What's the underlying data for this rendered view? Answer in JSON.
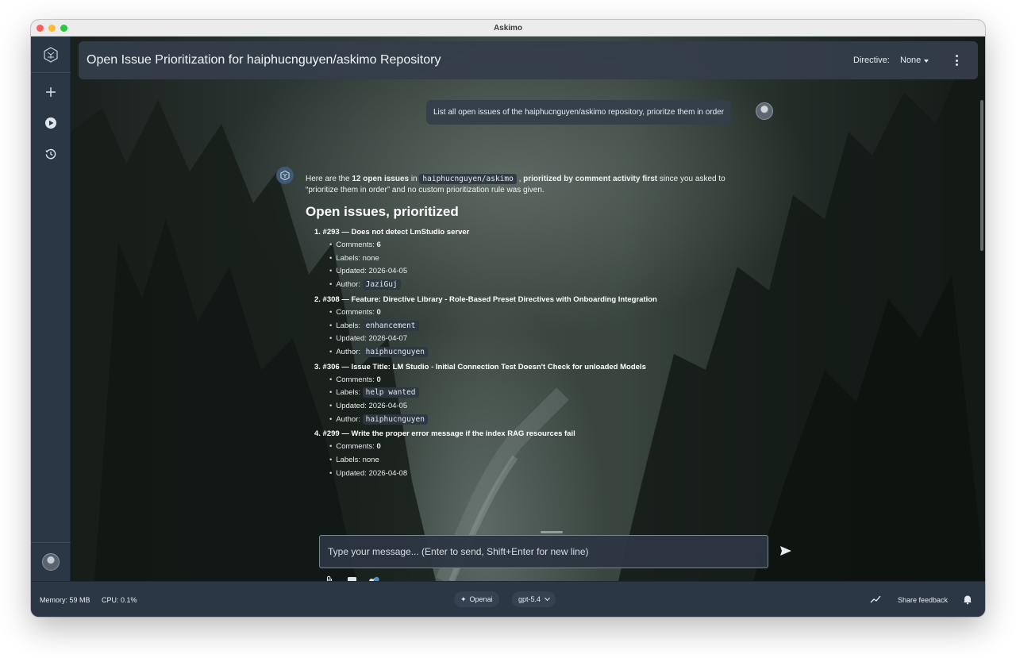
{
  "window": {
    "title": "Askimo"
  },
  "sidebar": {
    "items": [
      {
        "name": "new-chat",
        "icon": "plus-icon"
      },
      {
        "name": "play",
        "icon": "play-circle-icon"
      },
      {
        "name": "history",
        "icon": "history-icon"
      }
    ]
  },
  "header": {
    "title": "Open Issue Prioritization for haiphucnguyen/askimo Repository",
    "directive_label": "Directive:",
    "directive_value": "None"
  },
  "conversation": {
    "user_message": "List all open issues of the haiphucnguyen/askimo repository, prioritze them in order",
    "answer": {
      "intro_1": "Here are the ",
      "intro_bold_1": "12 open issues",
      "intro_2": " in ",
      "intro_code": "haiphucnguyen/askimo",
      "intro_3": " , ",
      "intro_bold_2": "prioritized by comment activity first",
      "intro_4": " since you asked to “prioritize them in order” and no custom prioritization rule was given.",
      "heading": "Open issues, prioritized",
      "issues": [
        {
          "title": "1. #293 — Does not detect LmStudio server",
          "comments_label": "Comments: ",
          "comments": "6",
          "labels_label": "Labels: ",
          "labels": "none",
          "labels_is_code": false,
          "updated": "Updated: 2026-04-05",
          "author_label": "Author: ",
          "author": "JaziGuj"
        },
        {
          "title": "2. #308 — Feature: Directive Library - Role-Based Preset Directives with Onboarding Integration",
          "comments_label": "Comments: ",
          "comments": "0",
          "labels_label": "Labels: ",
          "labels": "enhancement",
          "labels_is_code": true,
          "updated": "Updated: 2026-04-07",
          "author_label": "Author: ",
          "author": "haiphucnguyen"
        },
        {
          "title": "3. #306 — Issue Title: LM Studio - Initial Connection Test Doesn't Check for unloaded Models",
          "comments_label": "Comments: ",
          "comments": "0",
          "labels_label": "Labels: ",
          "labels": "help wanted",
          "labels_is_code": true,
          "updated": "Updated: 2026-04-05",
          "author_label": "Author: ",
          "author": "haiphucnguyen"
        },
        {
          "title": "4. #299 — Write the proper error message if the index RAG resources fail",
          "comments_label": "Comments: ",
          "comments": "0",
          "labels_label": "Labels: ",
          "labels": "none",
          "labels_is_code": false,
          "updated": "Updated: 2026-04-08",
          "author_label": "",
          "author": ""
        }
      ]
    }
  },
  "composer": {
    "placeholder": "Type your message... (Enter to send, Shift+Enter for new line)",
    "value": "",
    "tools": [
      "paperclip-icon",
      "image-icon",
      "mcp-tool-icon"
    ]
  },
  "statusbar": {
    "memory": "Memory: 59 MB",
    "cpu": "CPU: 0.1%",
    "provider": "Openai",
    "model": "gpt-5.4",
    "feedback": "Share feedback"
  },
  "colors": {
    "sidebar_bg": "#2c3745",
    "header_bg": "#343e4a",
    "text": "#eef2f5",
    "accent": "#3e5a74"
  }
}
